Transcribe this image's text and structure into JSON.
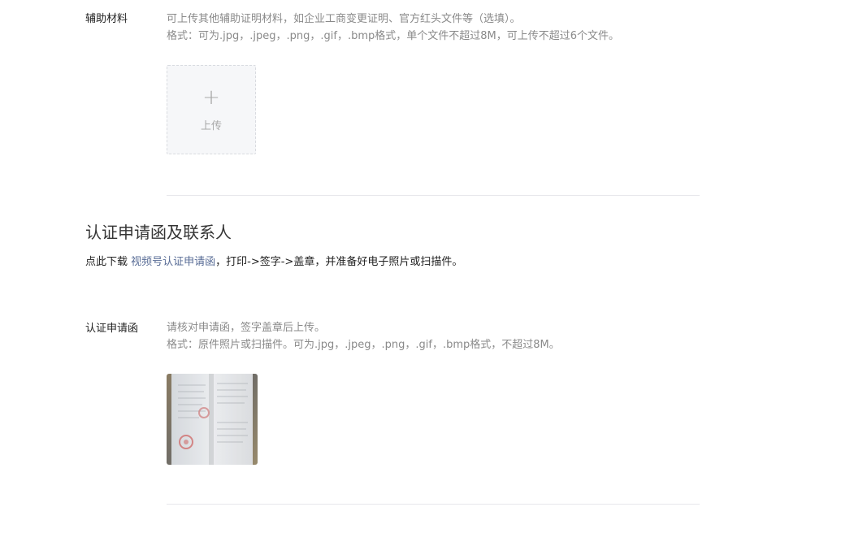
{
  "aux_materials": {
    "label": "辅助材料",
    "desc_line1": "可上传其他辅助证明材料，如企业工商变更证明、官方红头文件等（选填）。",
    "desc_line2": "格式：可为.jpg，.jpeg，.png，.gif，.bmp格式，单个文件不超过8M，可上传不超过6个文件。",
    "upload_plus": "+",
    "upload_label": "上传"
  },
  "section": {
    "title": "认证申请函及联系人",
    "download_prefix": "点此下载 ",
    "download_link": "视频号认证申请函",
    "download_suffix": "，打印->签字->盖章，并准备好电子照片或扫描件。"
  },
  "application_letter": {
    "label": "认证申请函",
    "desc_line1": "请核对申请函，签字盖章后上传。",
    "desc_line2": "格式：原件照片或扫描件。可为.jpg，.jpeg，.png，.gif，.bmp格式，不超过8M。"
  },
  "colors": {
    "link": "#576b95",
    "muted_text": "#8a8a8a",
    "divider": "#e7e7eb",
    "upload_bg": "#f6f7f9"
  }
}
